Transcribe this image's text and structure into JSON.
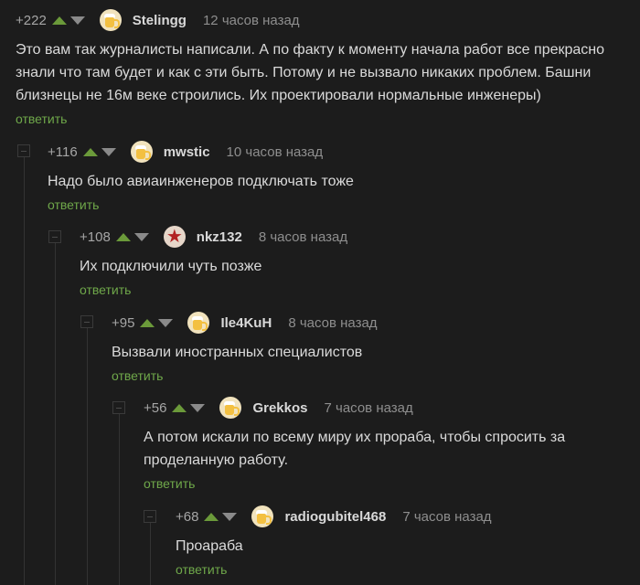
{
  "comments": [
    {
      "rating": "+222",
      "username": "Stelingg",
      "time": "12 часов назад",
      "avatar": "beer-mug",
      "text": "Это вам так журналисты написали. А по факту к моменту начала работ все прекрасно\nзнали что там будет и как с эти быть. Потому и не вызвало никаких проблем. Башни\nблизнецы не 16м веке строились. Их проектировали нормальные инженеры)",
      "reply": "ответить"
    },
    {
      "rating": "+116",
      "username": "mwstic",
      "time": "10 часов назад",
      "avatar": "beer-mug",
      "text": "Надо было авиаинженеров подключать тоже",
      "reply": "ответить"
    },
    {
      "rating": "+108",
      "username": "nkz132",
      "time": "8 часов назад",
      "avatar": "red-star",
      "text": "Их подключили чуть позже",
      "reply": "ответить"
    },
    {
      "rating": "+95",
      "username": "Ile4KuH",
      "time": "8 часов назад",
      "avatar": "beer-mug",
      "text": "Вызвали иностранных специалистов",
      "reply": "ответить"
    },
    {
      "rating": "+56",
      "username": "Grekkos",
      "time": "7 часов назад",
      "avatar": "beer-mug",
      "text": "А потом искали по всему миру их прораба, чтобы спросить за\nпроделанную работу.",
      "reply": "ответить"
    },
    {
      "rating": "+68",
      "username": "radiogubitel468",
      "time": "7 часов назад",
      "avatar": "beer-mug",
      "text": "Проараба",
      "reply": "ответить"
    }
  ],
  "colors": {
    "background": "#1c1c1c",
    "upvote": "#6b9a3a",
    "reply_link": "#6fa84a",
    "text": "#dadada",
    "muted": "#8e8e8e"
  }
}
